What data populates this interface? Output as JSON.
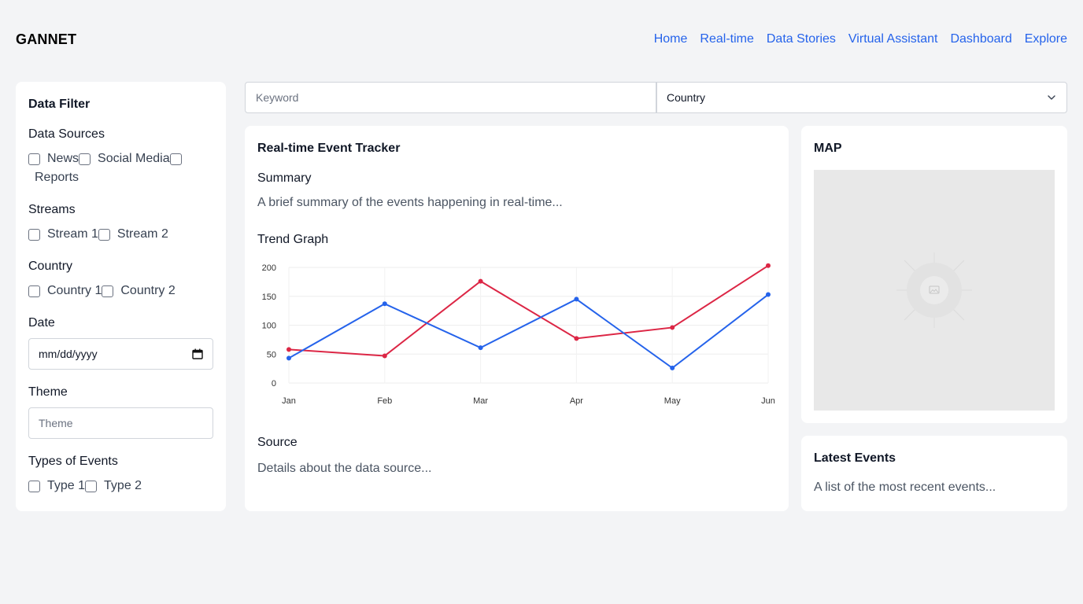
{
  "app": {
    "logo": "GANNET"
  },
  "nav": [
    "Home",
    "Real-time",
    "Data Stories",
    "Virtual Assistant",
    "Dashboard",
    "Explore"
  ],
  "filter": {
    "title": "Data Filter",
    "sources_title": "Data Sources",
    "sources": [
      "News",
      "Social Media",
      "Reports"
    ],
    "streams_title": "Streams",
    "streams": [
      "Stream 1",
      "Stream 2"
    ],
    "country_title": "Country",
    "countries": [
      "Country 1",
      "Country 2"
    ],
    "date_title": "Date",
    "date_placeholder": "mm/dd/yyyy",
    "theme_title": "Theme",
    "theme_placeholder": "Theme",
    "types_title": "Types of Events",
    "types": [
      "Type 1",
      "Type 2"
    ]
  },
  "search": {
    "keyword_placeholder": "Keyword",
    "country_value": "Country"
  },
  "tracker": {
    "title": "Real-time Event Tracker",
    "summary_title": "Summary",
    "summary_text": "A brief summary of the events happening in real-time...",
    "trend_title": "Trend Graph",
    "source_title": "Source",
    "source_text": "Details about the data source..."
  },
  "map": {
    "title": "MAP"
  },
  "latest": {
    "title": "Latest Events",
    "text": "A list of the most recent events..."
  },
  "chart_data": {
    "type": "line",
    "categories": [
      "Jan",
      "Feb",
      "Mar",
      "Apr",
      "May",
      "Jun"
    ],
    "series": [
      {
        "values": [
          58,
          47,
          176,
          77,
          96,
          203
        ],
        "color": "#dc2645"
      },
      {
        "values": [
          43,
          137,
          61,
          145,
          26,
          153
        ],
        "color": "#2563eb"
      }
    ],
    "yticks": [
      0,
      50,
      100,
      150,
      200
    ],
    "ylim": [
      0,
      200
    ],
    "grid": true
  }
}
